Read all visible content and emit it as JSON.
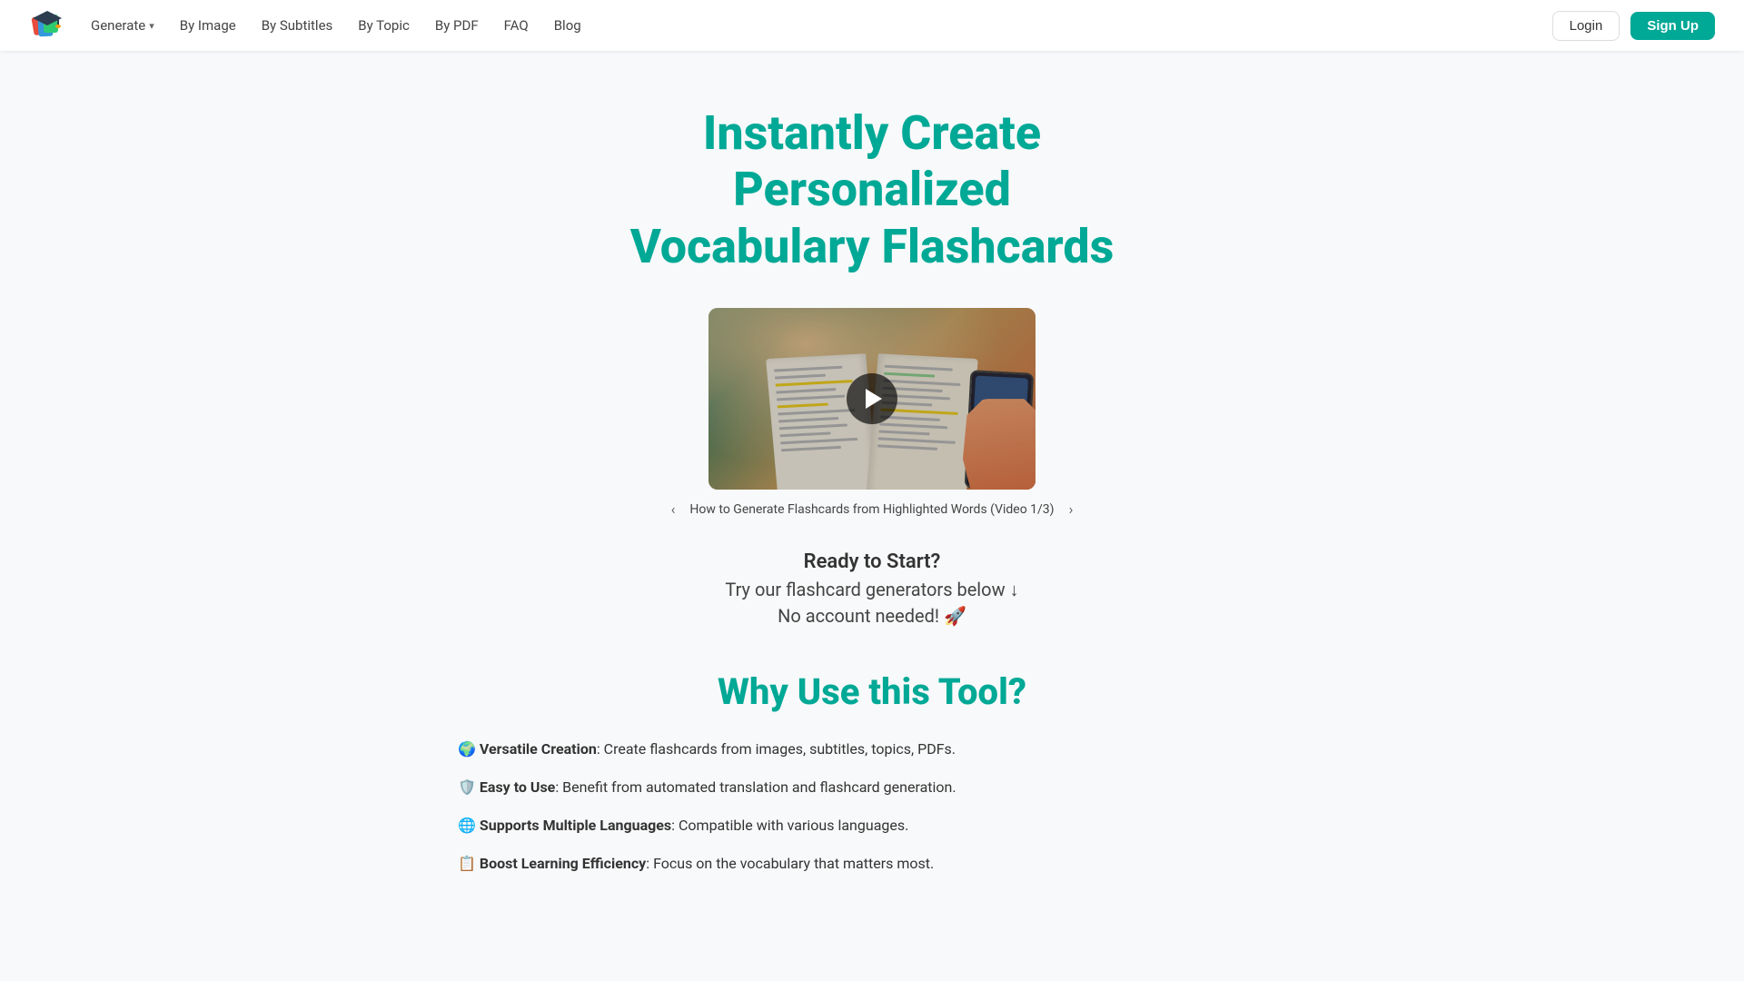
{
  "navbar": {
    "generate_label": "Generate",
    "by_image_label": "By Image",
    "by_subtitles_label": "By Subtitles",
    "by_topic_label": "By Topic",
    "by_pdf_label": "By PDF",
    "faq_label": "FAQ",
    "blog_label": "Blog",
    "login_label": "Login",
    "signup_label": "Sign Up"
  },
  "hero": {
    "title_line1": "Instantly Create",
    "title_line2": "Personalized",
    "title_line3": "Vocabulary Flashcards"
  },
  "video": {
    "caption": "How to Generate Flashcards from Highlighted Words (Video 1/3)"
  },
  "cta": {
    "ready": "Ready to Start?",
    "sub": "Try our flashcard generators below ↓",
    "no_account": "No account needed! 🚀"
  },
  "why": {
    "title": "Why Use this Tool?",
    "features": [
      {
        "icon": "🌍",
        "label": "Versatile Creation",
        "description": ": Create flashcards from images, subtitles, topics, PDFs."
      },
      {
        "icon": "🛡️",
        "label": "Easy to Use",
        "description": ": Benefit from automated translation and flashcard generation."
      },
      {
        "icon": "🌐",
        "label": "Supports Multiple Languages",
        "description": ": Compatible with various languages."
      },
      {
        "icon": "📋",
        "label": "Boost Learning Efficiency",
        "description": ": Focus on the vocabulary that matters most."
      }
    ]
  },
  "colors": {
    "teal": "#00a896",
    "teal_dark": "#008f7e"
  }
}
